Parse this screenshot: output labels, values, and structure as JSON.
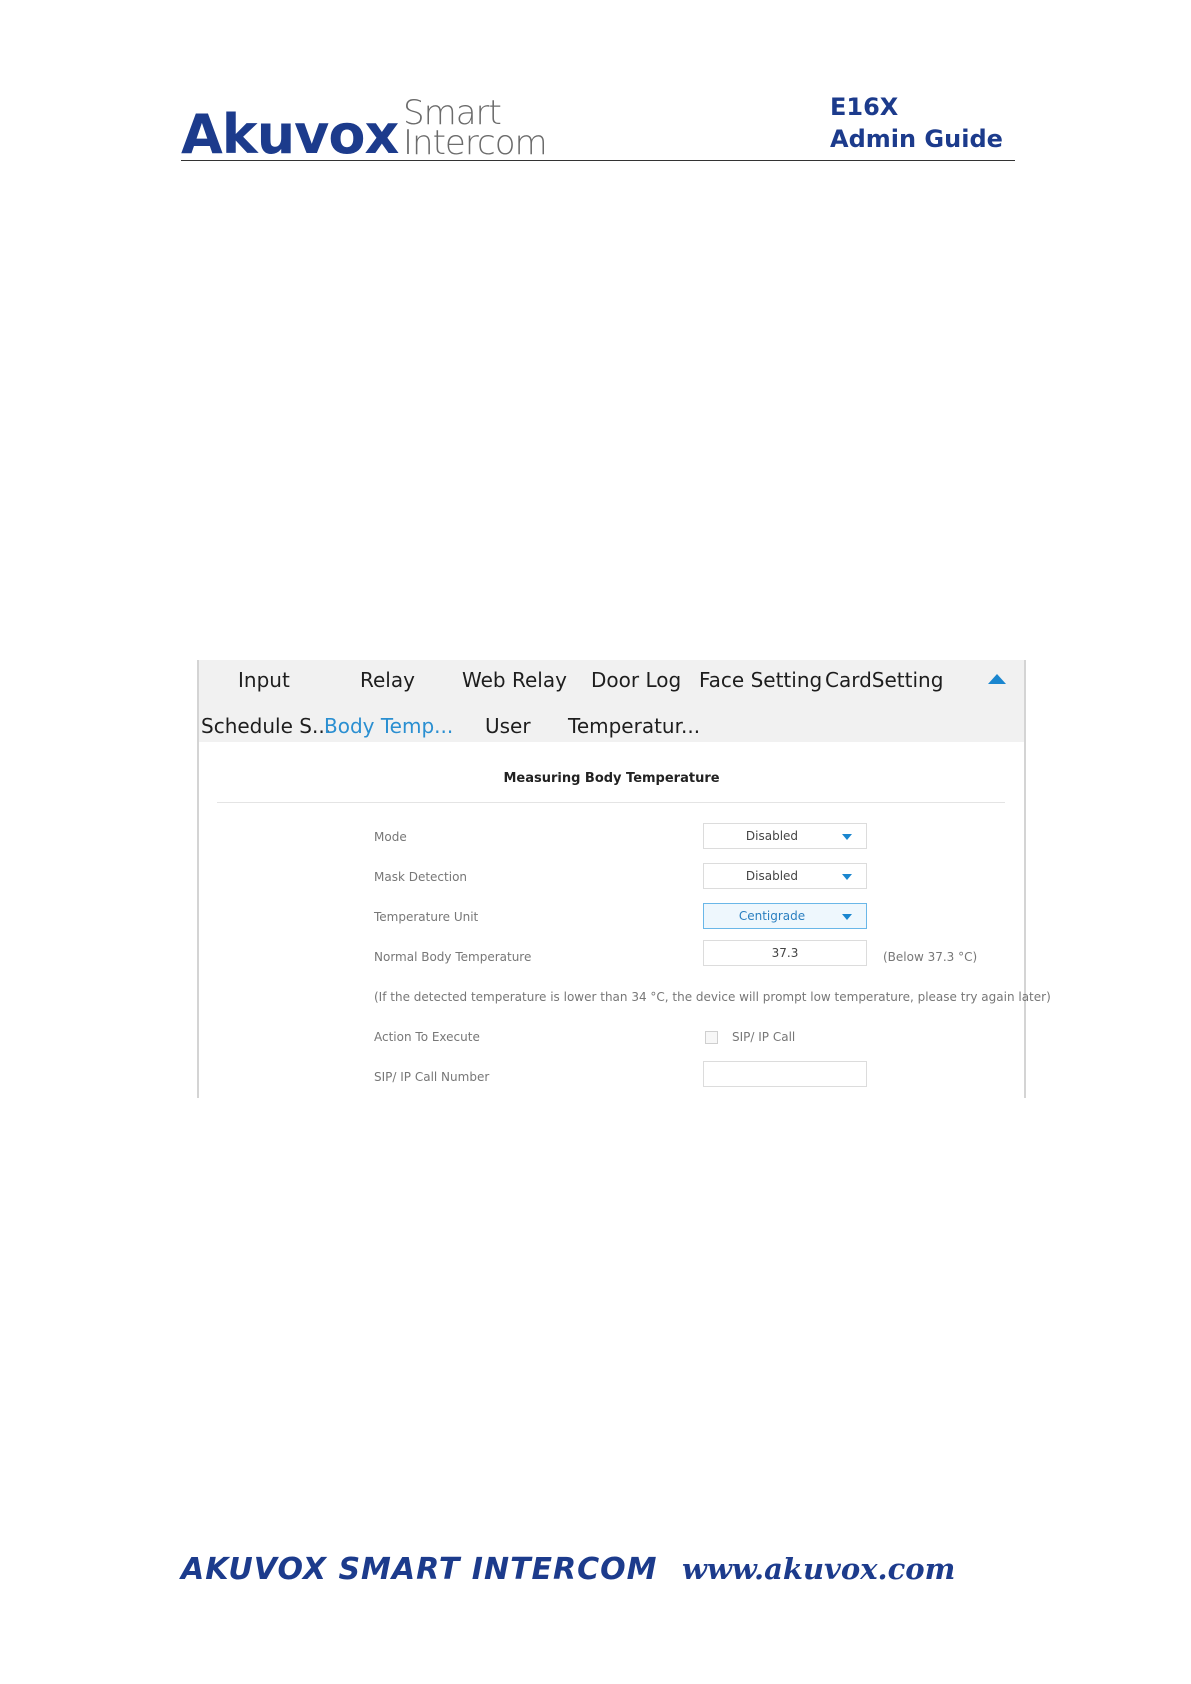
{
  "header": {
    "brand": "Akuvox",
    "brand_sub_line1": "Smart",
    "brand_sub_line2": "Intercom",
    "model": "E16X",
    "doc_type": "Admin Guide"
  },
  "tabs": {
    "row1": [
      "Input",
      "Relay",
      "Web Relay",
      "Door Log",
      "Face Setting",
      "CardSetting"
    ],
    "row2": [
      "Schedule S...",
      "Body Temp...",
      "User",
      "Temperatur..."
    ],
    "active": "Body Temp...",
    "collapse_icon": "triangle-up-icon"
  },
  "section": {
    "title": "Measuring Body Temperature",
    "mode": {
      "label": "Mode",
      "value": "Disabled"
    },
    "mask_detection": {
      "label": "Mask Detection",
      "value": "Disabled"
    },
    "temperature_unit": {
      "label": "Temperature Unit",
      "value": "Centigrade"
    },
    "normal_body_temperature": {
      "label": "Normal Body Temperature",
      "value": "37.3",
      "hint": "(Below 37.3 °C)"
    },
    "low_temp_note": "(If the detected temperature is lower than 34 °C, the device will prompt low temperature, please try again later)",
    "action_to_execute": {
      "label": "Action To Execute",
      "option": "SIP/ IP Call",
      "checked": false
    },
    "sip_ip_call_number": {
      "label": "SIP/ IP Call Number",
      "value": ""
    }
  },
  "footer": {
    "left": "AKUVOX SMART INTERCOM",
    "right": "www.akuvox.com"
  },
  "colors": {
    "brand_blue": "#1c3b8c",
    "accent_blue": "#2a8fd1"
  }
}
